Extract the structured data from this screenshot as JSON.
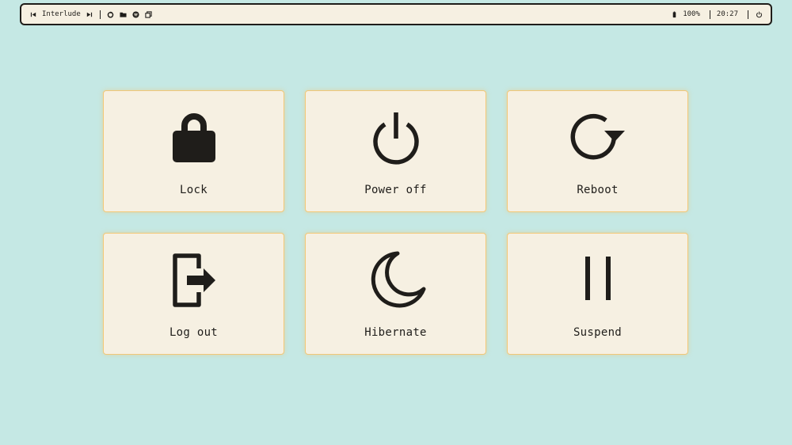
{
  "topbar": {
    "track_title": "Interlude",
    "left_icons": [
      "previous-track-icon",
      "next-track-icon",
      "refresh-icon",
      "folder-icon",
      "spotify-icon",
      "window-switch-icon"
    ],
    "battery_text": "100%",
    "clock": "20:27",
    "right_icons": [
      "battery-icon",
      "power-icon"
    ]
  },
  "tiles": [
    {
      "label": "Lock",
      "icon": "lock-icon"
    },
    {
      "label": "Power off",
      "icon": "power-icon"
    },
    {
      "label": "Reboot",
      "icon": "reboot-icon"
    },
    {
      "label": "Log out",
      "icon": "logout-icon"
    },
    {
      "label": "Hibernate",
      "icon": "moon-icon"
    },
    {
      "label": "Suspend",
      "icon": "pause-icon"
    }
  ],
  "colors": {
    "background": "#c5e8e4",
    "panel": "#f6f0e2",
    "tile_border": "#f2c777",
    "foreground": "#1f1d1a"
  }
}
